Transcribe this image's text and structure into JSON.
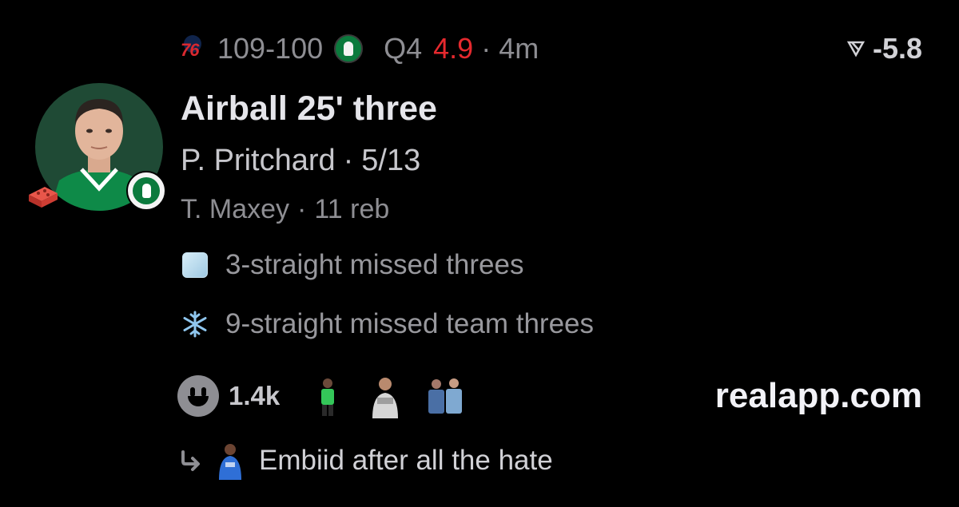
{
  "header": {
    "home_logo_text": "76",
    "score": "109-100",
    "period": "Q4",
    "clock": "4.9",
    "age": "4m",
    "odds": "-5.8"
  },
  "play": {
    "title": "Airball 25' three",
    "player": "P. Pritchard",
    "player_stat": "5/13",
    "secondary_player": "T. Maxey",
    "secondary_stat": "11 reb"
  },
  "notes": [
    {
      "icon": "ice-cube-icon",
      "text": "3-straight missed threes"
    },
    {
      "icon": "snowflake-icon",
      "text": "9-straight missed team threes"
    }
  ],
  "reactions": {
    "count": "1.4k"
  },
  "brand": "realapp.com",
  "reply": {
    "text": "Embiid after all the hate"
  },
  "colors": {
    "background": "#000000",
    "clock": "#e5292e",
    "celtics_green": "#0b7a3d",
    "sixers_red": "#d8282f",
    "sixers_blue": "#1d4289"
  }
}
